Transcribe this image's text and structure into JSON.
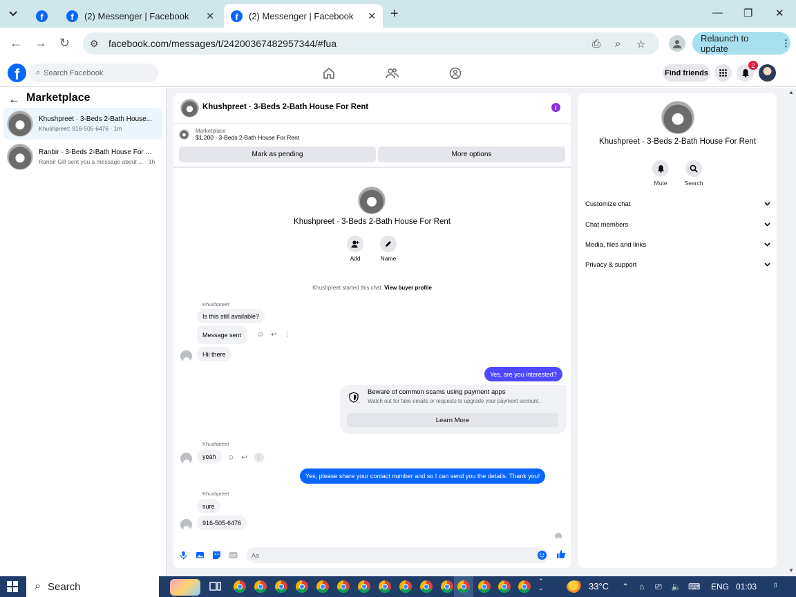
{
  "browser": {
    "tabs": [
      {
        "title": "(2) Messenger | Facebook",
        "active": false
      },
      {
        "title": "(2) Messenger | Facebook",
        "active": true
      }
    ],
    "url": "facebook.com/messages/t/24200367482957344/#fua",
    "relaunch_label": "Relaunch to update"
  },
  "fb_header": {
    "search_placeholder": "Search Facebook",
    "find_friends": "Find friends",
    "notification_count": "2"
  },
  "left_panel": {
    "title": "Marketplace",
    "conversations": [
      {
        "name": "Khushpreet · 3-Beds 2-Bath House...",
        "preview": "Khushpreet: 916-505-6476 · 1m",
        "active": true
      },
      {
        "name": "Ranbir · 3-Beds 2-Bath House For ...",
        "preview": "Ranbir Gill sent you a message about ... · 1h",
        "active": false
      }
    ]
  },
  "chat": {
    "header_title": "Khushpreet · 3-Beds 2-Bath House For Rent",
    "marketplace_label": "Marketplace",
    "marketplace_item": "$1,200 - 3-Beds 2-Bath House For Rent",
    "mark_pending": "Mark as pending",
    "more_options": "More options",
    "profile_name": "Khushpreet · 3-Beds 2-Bath House For Rent",
    "add_label": "Add",
    "name_label": "Name",
    "system_msg": "Khushpreet started this chat.",
    "view_buyer": "View buyer profile",
    "sender_name": "Khushpreet",
    "messages": {
      "m1": "Is this still available?",
      "m2": "Message sent",
      "m3": "Hii there",
      "m4": "Yes, are you interested?",
      "m5": "yeah",
      "m6": "Yes, please share your contact number and so I can send you the details. Thank you!",
      "m7": "sure",
      "m8": "916-505-6476"
    },
    "scam_card": {
      "title": "Beware of common scams using payment apps",
      "subtitle": "Watch out for fake emails or requests to upgrade your payment account.",
      "button": "Learn More"
    },
    "composer_placeholder": "Aa"
  },
  "info_panel": {
    "name": "Khushpreet · 3-Beds 2-Bath House For Rent",
    "mute_label": "Mute",
    "search_label": "Search",
    "sections": [
      "Customize chat",
      "Chat members",
      "Media, files and links",
      "Privacy & support"
    ]
  },
  "taskbar": {
    "search_label": "Search",
    "temperature": "33°C",
    "language": "ENG",
    "time": "01:03"
  },
  "colors": {
    "fb_blue": "#0866ff",
    "outgoing_purple": "#4e49ff",
    "badge_red": "#e41e3f",
    "taskbar": "#203c69"
  }
}
